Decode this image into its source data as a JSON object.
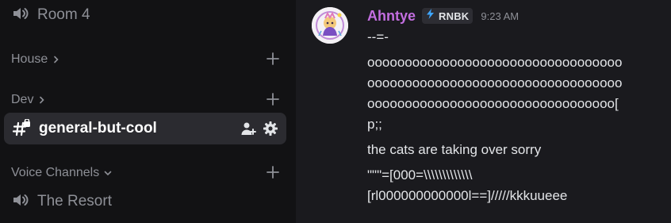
{
  "sidebar": {
    "voice_top": {
      "label": "Room 4",
      "icon": "speaker-icon"
    },
    "categories": [
      {
        "label": "House",
        "icon": "chevron-right-icon"
      },
      {
        "label": "Dev",
        "icon": "chevron-right-icon"
      },
      {
        "label": "Voice Channels",
        "icon": "chevron-down-icon"
      }
    ],
    "active_channel": {
      "label": "general-but-cool",
      "icon": "locked-hash-icon"
    },
    "voice_bottom": {
      "label": "The Resort",
      "icon": "speaker-icon"
    }
  },
  "message": {
    "username": "Ahntye",
    "username_color": "#c36ee0",
    "tag": "RNBK",
    "tag_icon": "lightning-icon",
    "timestamp": "9:23 AM",
    "lines": [
      "--=-",
      "oooooooooooooooooooooooooooooooooo",
      "oooooooooooooooooooooooooooooooooo",
      "ooooooooooooooooooooooooooooooooo[",
      "p;;",
      "the cats are taking over sorry",
      "\"\"\"=[000=\\\\\\\\\\\\\\\\\\\\\\\\\\",
      "[rl000000000000l==]/////kkkuueee"
    ]
  }
}
